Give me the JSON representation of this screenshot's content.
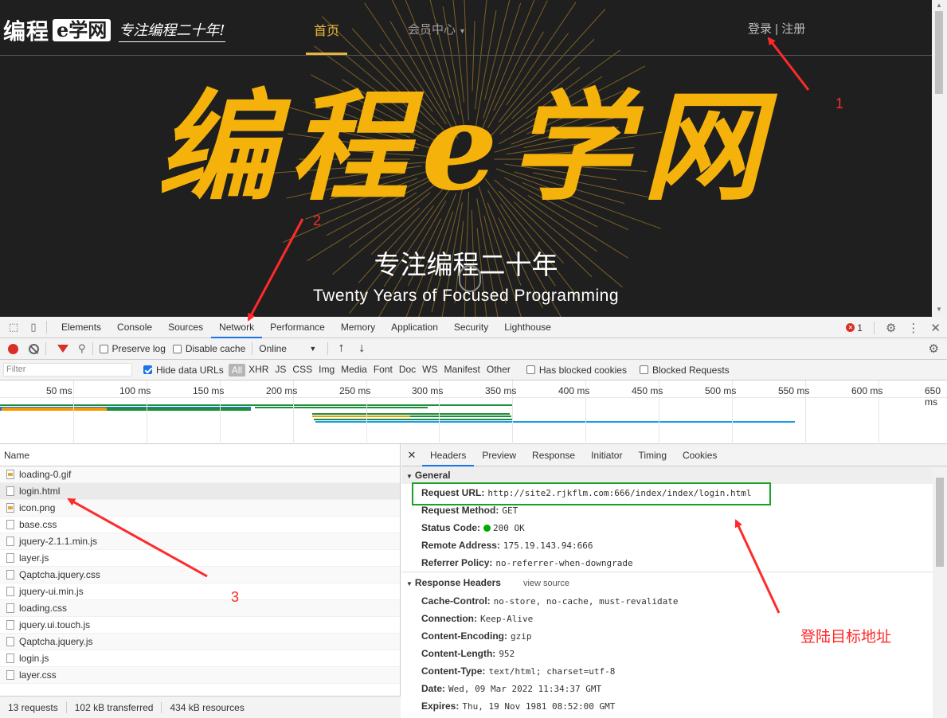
{
  "site": {
    "logo": "编程",
    "logo_badge": "e学网",
    "slogan": "专注编程二十年!",
    "nav": {
      "home": "首页",
      "member": "会员中心",
      "auth": "登录 | 注册"
    },
    "hero_title": "编程e学网",
    "hero_subtitle": "专注编程二十年",
    "hero_english": "Twenty Years of Focused Programming"
  },
  "devtools": {
    "tabs": [
      "Elements",
      "Console",
      "Sources",
      "Network",
      "Performance",
      "Memory",
      "Application",
      "Security",
      "Lighthouse"
    ],
    "active_tab": "Network",
    "error_count": "1",
    "toolbar": {
      "preserve_log": "Preserve log",
      "disable_cache": "Disable cache",
      "throttle": "Online"
    },
    "filter": {
      "placeholder": "Filter",
      "hide_data_urls": "Hide data URLs",
      "types": [
        "All",
        "XHR",
        "JS",
        "CSS",
        "Img",
        "Media",
        "Font",
        "Doc",
        "WS",
        "Manifest",
        "Other"
      ],
      "has_blocked_cookies": "Has blocked cookies",
      "blocked_requests": "Blocked Requests"
    },
    "timeline_ticks": [
      "50 ms",
      "100 ms",
      "150 ms",
      "200 ms",
      "250 ms",
      "300 ms",
      "350 ms",
      "400 ms",
      "450 ms",
      "500 ms",
      "550 ms",
      "600 ms",
      "650 ms"
    ],
    "name_header": "Name",
    "requests": [
      "loading-0.gif",
      "login.html",
      "icon.png",
      "base.css",
      "jquery-2.1.1.min.js",
      "layer.js",
      "Qaptcha.jquery.css",
      "jquery-ui.min.js",
      "loading.css",
      "jquery.ui.touch.js",
      "Qaptcha.jquery.js",
      "login.js",
      "layer.css"
    ],
    "status": {
      "requests": "13 requests",
      "transferred": "102 kB transferred",
      "resources": "434 kB resources"
    },
    "detail_tabs": [
      "Headers",
      "Preview",
      "Response",
      "Initiator",
      "Timing",
      "Cookies"
    ],
    "general": {
      "title": "General",
      "rows": [
        {
          "k": "Request URL:",
          "v": "http://site2.rjkflm.com:666/index/index/login.html"
        },
        {
          "k": "Request Method:",
          "v": "GET"
        },
        {
          "k": "Status Code:",
          "v": "200 OK"
        },
        {
          "k": "Remote Address:",
          "v": "175.19.143.94:666"
        },
        {
          "k": "Referrer Policy:",
          "v": "no-referrer-when-downgrade"
        }
      ]
    },
    "response_headers": {
      "title": "Response Headers",
      "view_source": "view source",
      "rows": [
        {
          "k": "Cache-Control:",
          "v": "no-store, no-cache, must-revalidate"
        },
        {
          "k": "Connection:",
          "v": "Keep-Alive"
        },
        {
          "k": "Content-Encoding:",
          "v": "gzip"
        },
        {
          "k": "Content-Length:",
          "v": "952"
        },
        {
          "k": "Content-Type:",
          "v": "text/html; charset=utf-8"
        },
        {
          "k": "Date:",
          "v": "Wed, 09 Mar 2022 11:34:37 GMT"
        },
        {
          "k": "Expires:",
          "v": "Thu, 19 Nov 1981 08:52:00 GMT"
        }
      ]
    }
  },
  "annotations": {
    "n1": "1",
    "n2": "2",
    "n3": "3",
    "target_label": "登陆目标地址"
  },
  "colors": {
    "accent": "#f5b20b",
    "devtools_blue": "#1a73e8",
    "annotation_red": "#ff2a2a",
    "highlight_green": "#16a326"
  }
}
